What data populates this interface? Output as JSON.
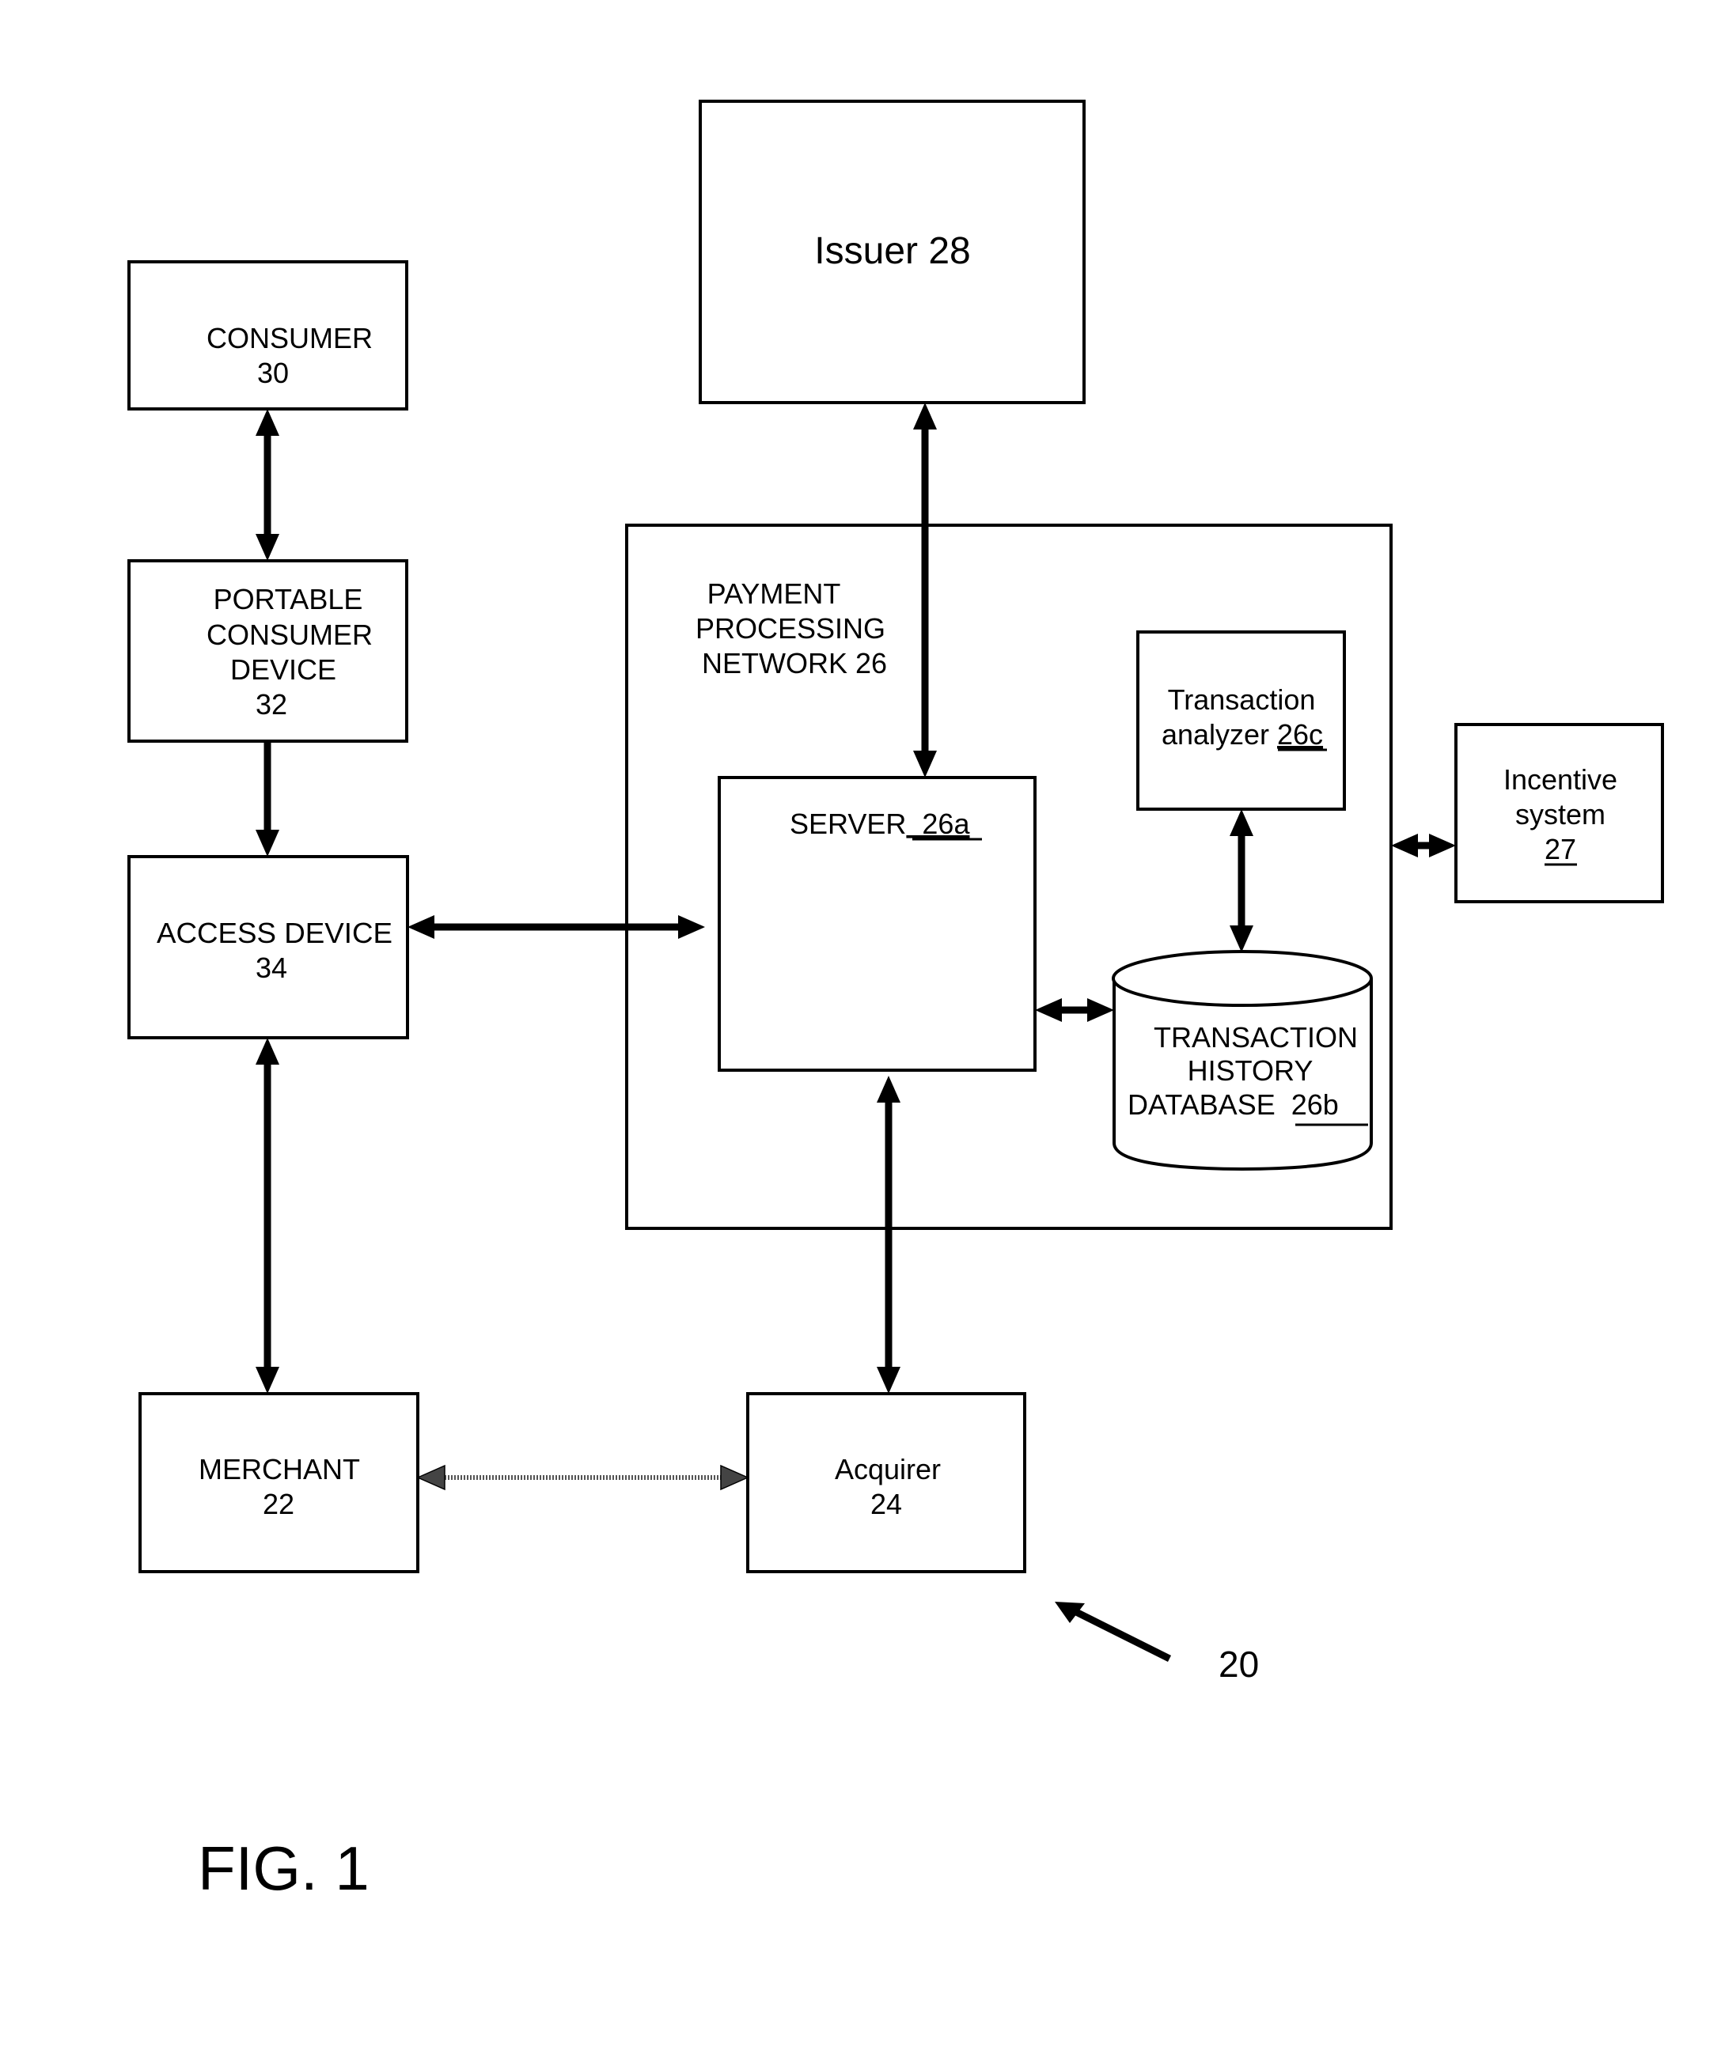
{
  "figure": {
    "caption": "FIG. 1",
    "reference_numeral": "20"
  },
  "nodes": {
    "consumer": {
      "lines": [
        "CONSUMER",
        "30"
      ]
    },
    "portable_device": {
      "lines": [
        "PORTABLE",
        "CONSUMER",
        "DEVICE",
        "32"
      ]
    },
    "access_device": {
      "lines": [
        "ACCESS DEVICE",
        "34"
      ]
    },
    "merchant": {
      "lines": [
        "MERCHANT",
        "22"
      ]
    },
    "acquirer": {
      "lines": [
        "Acquirer",
        "24"
      ]
    },
    "issuer": {
      "lines": [
        "Issuer 28"
      ]
    },
    "payment_network": {
      "lines": [
        "PAYMENT",
        "PROCESSING",
        "NETWORK 26"
      ]
    },
    "server": {
      "label": "SERVER",
      "ref": "  26a"
    },
    "transaction_analyzer": {
      "line1": "Transaction",
      "line2_text": "analyzer ",
      "line2_ref": "26c"
    },
    "history_db": {
      "line1": "TRANSACTION",
      "line2": "HISTORY",
      "line3_text": "DATABASE ",
      "line3_ref": " 26b  "
    },
    "incentive": {
      "line1": "Incentive",
      "line2": "system",
      "ref": "27"
    }
  },
  "connections": [
    {
      "from": "consumer",
      "to": "portable_device",
      "type": "bidirectional"
    },
    {
      "from": "portable_device",
      "to": "access_device",
      "type": "unidirectional"
    },
    {
      "from": "access_device",
      "to": "server",
      "type": "bidirectional"
    },
    {
      "from": "access_device",
      "to": "merchant",
      "type": "bidirectional"
    },
    {
      "from": "merchant",
      "to": "acquirer",
      "type": "bidirectional-dotted"
    },
    {
      "from": "acquirer",
      "to": "server",
      "type": "bidirectional"
    },
    {
      "from": "issuer",
      "to": "server",
      "type": "bidirectional"
    },
    {
      "from": "server",
      "to": "history_db",
      "type": "bidirectional"
    },
    {
      "from": "transaction_analyzer",
      "to": "history_db",
      "type": "bidirectional"
    },
    {
      "from": "payment_network",
      "to": "incentive",
      "type": "bidirectional"
    }
  ]
}
